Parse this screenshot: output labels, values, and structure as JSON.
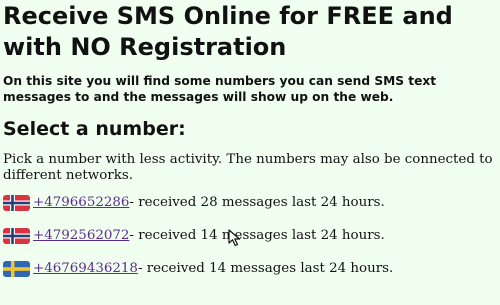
{
  "header": {
    "title": "Receive SMS Online for FREE and with NO Registration",
    "intro": "On this site you will find some numbers you can send SMS text messages to and the messages will show up on the web."
  },
  "numbers_section": {
    "heading": "Select a number:",
    "description": "Pick a number with less activity. The numbers may also be connected to different networks.",
    "items": [
      {
        "flag": "norway-flag-icon",
        "number": "+4796652286",
        "status": " - received 28 messages last 24 hours."
      },
      {
        "flag": "norway-flag-icon",
        "number": "+4792562072",
        "status": " - received 14 messages last 24 hours."
      },
      {
        "flag": "sweden-flag-icon",
        "number": "+46769436218",
        "status": " - received 14 messages last 24 hours."
      }
    ]
  },
  "colors": {
    "background": "#f0fff0",
    "text": "#111111",
    "link": "#5a2d91",
    "norway_red": "#d9343f",
    "norway_blue": "#253d7c",
    "sweden_blue": "#2e67b3",
    "sweden_yellow": "#f1c62c"
  }
}
